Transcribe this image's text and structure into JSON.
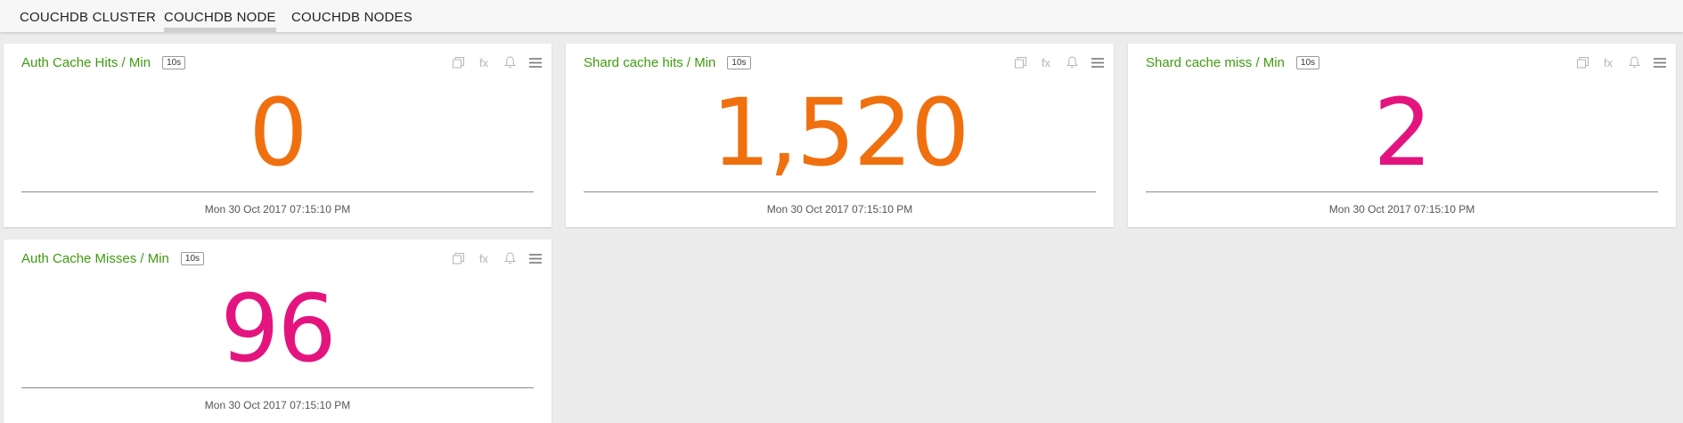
{
  "tabs": [
    {
      "label": "COUCHDB CLUSTER",
      "active": false
    },
    {
      "label": "COUCHDB NODE",
      "active": true
    },
    {
      "label": "COUCHDB NODES",
      "active": false
    }
  ],
  "colors": {
    "title": "#3f9b10",
    "orange": "#f07010",
    "magenta": "#e4147f"
  },
  "panels": [
    {
      "title": "Auth Cache Hits / Min",
      "interval": "10s",
      "value": "0",
      "value_color": "orange",
      "timestamp": "Mon 30 Oct 2017 07:15:10 PM"
    },
    {
      "title": "Shard cache hits / Min",
      "interval": "10s",
      "value": "1,520",
      "value_color": "orange",
      "timestamp": "Mon 30 Oct 2017 07:15:10 PM"
    },
    {
      "title": "Shard cache miss / Min",
      "interval": "10s",
      "value": "2",
      "value_color": "magenta",
      "timestamp": "Mon 30 Oct 2017 07:15:10 PM"
    },
    {
      "title": "Auth Cache Misses / Min",
      "interval": "10s",
      "value": "96",
      "value_color": "magenta",
      "timestamp": "Mon 30 Oct 2017 07:15:10 PM"
    }
  ],
  "panel_icons": [
    "copy-icon",
    "fx-icon",
    "bell-icon",
    "menu-icon"
  ],
  "fx_label": "fx"
}
